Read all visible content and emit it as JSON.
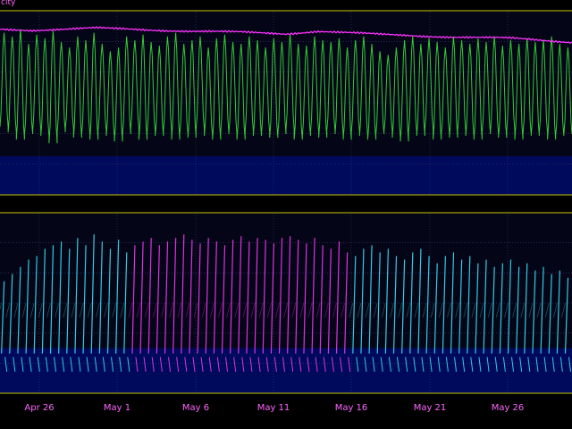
{
  "chart_data": [
    {
      "type": "line",
      "title_fragment": "city",
      "x_tick_labels": [
        "Apr 26",
        "May 1",
        "May 6",
        "May 11",
        "May 16",
        "May 21",
        "May 26"
      ],
      "x_range": [
        "Apr 24",
        "May 29"
      ],
      "grid": true,
      "background": "#000a5c",
      "series": [
        {
          "color": "#ff33ff",
          "level_upper": 0.93,
          "level_lower": 0.86,
          "values_frac": [
            0.9,
            0.895,
            0.9,
            0.905,
            0.9,
            0.895,
            0.89,
            0.885,
            0.88,
            0.875,
            0.89,
            0.88,
            0.87,
            0.865,
            0.86,
            0.855,
            0.85,
            0.84,
            0.83
          ]
        },
        {
          "color": "#33cc33",
          "cycles": 70,
          "peaks_frac": [
            0.88,
            0.86,
            0.9,
            0.82,
            0.87,
            0.85,
            0.89,
            0.83,
            0.8,
            0.86,
            0.84,
            0.88,
            0.82,
            0.78,
            0.8,
            0.86,
            0.84,
            0.87,
            0.83,
            0.81,
            0.86,
            0.88,
            0.82,
            0.84,
            0.86,
            0.8,
            0.85,
            0.87,
            0.83,
            0.82,
            0.86,
            0.84,
            0.8,
            0.85,
            0.83,
            0.87,
            0.82,
            0.81,
            0.86,
            0.84,
            0.83,
            0.85,
            0.8,
            0.84,
            0.86,
            0.82,
            0.78,
            0.76,
            0.8,
            0.84,
            0.86,
            0.82,
            0.85,
            0.83,
            0.8,
            0.86,
            0.84,
            0.82,
            0.85,
            0.83,
            0.86,
            0.81,
            0.84,
            0.82,
            0.85,
            0.83,
            0.84,
            0.86,
            0.82,
            0.8
          ],
          "troughs_frac": [
            0.37,
            0.34,
            0.3,
            0.33,
            0.35,
            0.32,
            0.28,
            0.34,
            0.36,
            0.31,
            0.33,
            0.3,
            0.35,
            0.32,
            0.29,
            0.33,
            0.36,
            0.3,
            0.34,
            0.32,
            0.35,
            0.3,
            0.33,
            0.31,
            0.36,
            0.32,
            0.3,
            0.34,
            0.33,
            0.3,
            0.35,
            0.32,
            0.34,
            0.31,
            0.33,
            0.36,
            0.3,
            0.32,
            0.34,
            0.31,
            0.35,
            0.33,
            0.3,
            0.34,
            0.32,
            0.3,
            0.33,
            0.35,
            0.31,
            0.29,
            0.34,
            0.32,
            0.36,
            0.3,
            0.33,
            0.31,
            0.35,
            0.32,
            0.3,
            0.34,
            0.33,
            0.31,
            0.35,
            0.3,
            0.33,
            0.32,
            0.34,
            0.3,
            0.32,
            0.33
          ]
        }
      ]
    },
    {
      "type": "line",
      "x_tick_labels": [
        "Apr 26",
        "May 1",
        "May 6",
        "May 11",
        "May 16",
        "May 21",
        "May 26"
      ],
      "grid": true,
      "background": "#000a5c",
      "series": [
        {
          "color": "#33ccdd",
          "cycles": 70,
          "style": "sawtooth"
        },
        {
          "color": "#dd33dd",
          "cycles": 70,
          "style": "sawtooth"
        }
      ],
      "series_color_by_cycle": "ccccccccccccccccmmmmmmmmmmmmmmmmmmmmmmmmmmmcccccccccccccccccccccccccccc",
      "peaks_frac": [
        0.62,
        0.66,
        0.7,
        0.74,
        0.76,
        0.8,
        0.82,
        0.84,
        0.8,
        0.86,
        0.82,
        0.88,
        0.84,
        0.8,
        0.85,
        0.78,
        0.82,
        0.84,
        0.86,
        0.82,
        0.84,
        0.86,
        0.88,
        0.85,
        0.83,
        0.86,
        0.84,
        0.82,
        0.85,
        0.87,
        0.84,
        0.86,
        0.85,
        0.83,
        0.86,
        0.87,
        0.85,
        0.83,
        0.86,
        0.82,
        0.8,
        0.84,
        0.78,
        0.76,
        0.8,
        0.82,
        0.78,
        0.8,
        0.76,
        0.74,
        0.78,
        0.8,
        0.76,
        0.72,
        0.76,
        0.78,
        0.74,
        0.76,
        0.72,
        0.74,
        0.7,
        0.72,
        0.74,
        0.7,
        0.72,
        0.68,
        0.7,
        0.66,
        0.68,
        0.64
      ]
    }
  ]
}
